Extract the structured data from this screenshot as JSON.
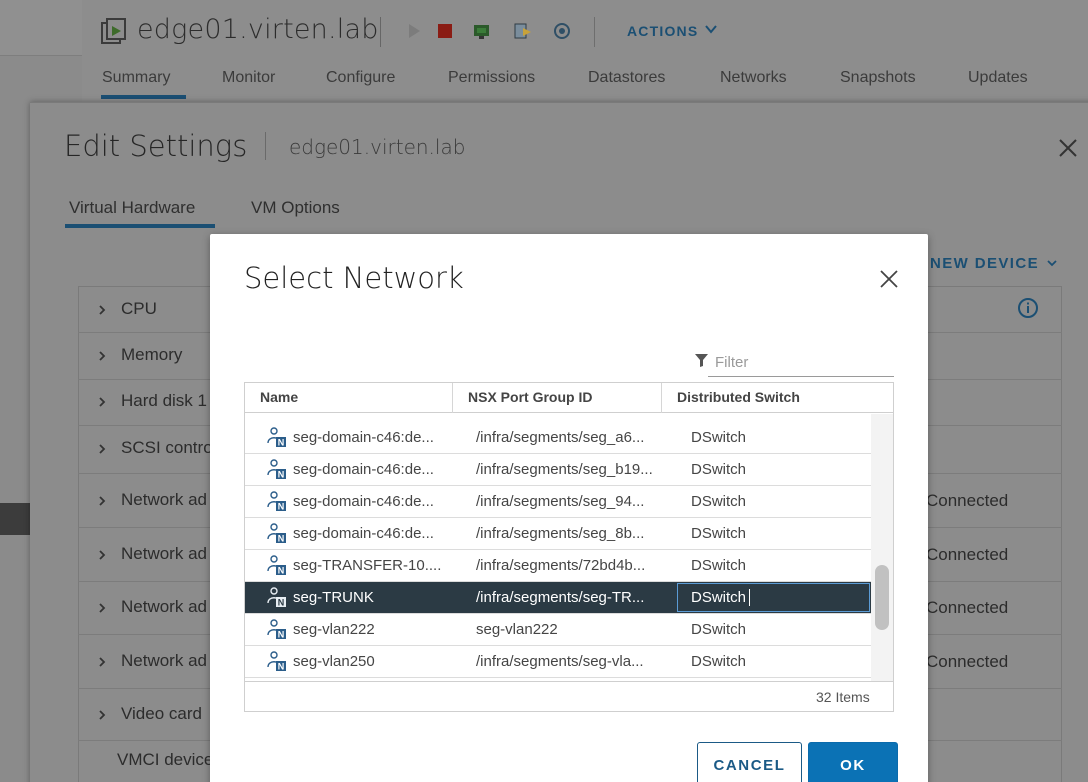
{
  "header": {
    "vm_title": "edge01.virten.lab",
    "actions_label": "ACTIONS",
    "nav_tabs": [
      "Summary",
      "Monitor",
      "Configure",
      "Permissions",
      "Datastores",
      "Networks",
      "Snapshots",
      "Updates"
    ],
    "active_tab": "Summary"
  },
  "edit_settings": {
    "title": "Edit Settings",
    "subtitle": "edge01.virten.lab",
    "tabs": [
      "Virtual Hardware",
      "VM Options"
    ],
    "active_tab": "Virtual Hardware",
    "add_device_label": "NEW DEVICE",
    "hardware": [
      {
        "label": "CPU",
        "status": ""
      },
      {
        "label": "Memory",
        "status": ""
      },
      {
        "label": "Hard disk 1",
        "status": ""
      },
      {
        "label": "SCSI contro",
        "status": ""
      },
      {
        "label": "Network ad",
        "status": "Connected"
      },
      {
        "label": "Network ad",
        "status": "Connected"
      },
      {
        "label": "Network ad",
        "status": "Connected"
      },
      {
        "label": "Network ad",
        "status": "Connected"
      },
      {
        "label": "Video card",
        "status": ""
      },
      {
        "label": "VMCI device",
        "status": ""
      }
    ]
  },
  "select_network": {
    "title": "Select Network",
    "filter_placeholder": "Filter",
    "columns": [
      "Name",
      "NSX Port Group ID",
      "Distributed Switch"
    ],
    "rows": [
      {
        "name": "seg-domain-c46:de...",
        "nsx_id": "/infra/segments/seg_a6...",
        "switch": "DSwitch",
        "selected": false
      },
      {
        "name": "seg-domain-c46:de...",
        "nsx_id": "/infra/segments/seg_b19...",
        "switch": "DSwitch",
        "selected": false
      },
      {
        "name": "seg-domain-c46:de...",
        "nsx_id": "/infra/segments/seg_94...",
        "switch": "DSwitch",
        "selected": false
      },
      {
        "name": "seg-domain-c46:de...",
        "nsx_id": "/infra/segments/seg_8b...",
        "switch": "DSwitch",
        "selected": false
      },
      {
        "name": "seg-TRANSFER-10....",
        "nsx_id": "/infra/segments/72bd4b...",
        "switch": "DSwitch",
        "selected": false
      },
      {
        "name": "seg-TRUNK",
        "nsx_id": "/infra/segments/seg-TR...",
        "switch": "DSwitch",
        "selected": true
      },
      {
        "name": "seg-vlan222",
        "nsx_id": "seg-vlan222",
        "switch": "DSwitch",
        "selected": false
      },
      {
        "name": "seg-vlan250",
        "nsx_id": "/infra/segments/seg-vla...",
        "switch": "DSwitch",
        "selected": false
      }
    ],
    "item_count": "32 Items",
    "cancel_label": "CANCEL",
    "ok_label": "OK"
  },
  "colors": {
    "accent": "#0b72b5",
    "selected_row": "#2b3a44",
    "link": "#1b4f73"
  },
  "icons": {
    "vm": "vm-icon",
    "network": "nsx-network-icon",
    "close": "close-icon",
    "filter": "filter-icon",
    "info": "info-icon",
    "chevron_right": "chevron-right-icon",
    "chevron_down": "chevron-down-icon"
  }
}
